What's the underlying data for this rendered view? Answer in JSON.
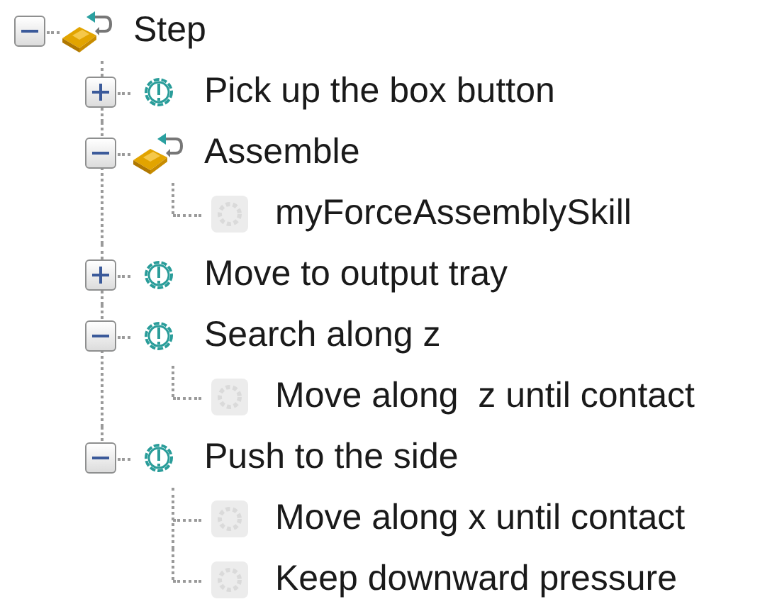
{
  "tree": [
    {
      "label": "Step",
      "kind": "sequence",
      "expanded": true,
      "children": [
        {
          "label": "Pick up the box button",
          "kind": "action",
          "expanded": false
        },
        {
          "label": "Assemble",
          "kind": "sequence",
          "expanded": true,
          "children": [
            {
              "label": "myForceAssemblySkill",
              "kind": "skill"
            }
          ]
        },
        {
          "label": "Move to output tray",
          "kind": "action",
          "expanded": false
        },
        {
          "label": "Search along z",
          "kind": "action",
          "expanded": true,
          "children": [
            {
              "label": "Move along  z until contact",
              "kind": "skill"
            }
          ]
        },
        {
          "label": "Push to the side",
          "kind": "action",
          "expanded": true,
          "children": [
            {
              "label": "Move along x until contact",
              "kind": "skill"
            },
            {
              "label": "Keep downward pressure",
              "kind": "skill"
            }
          ]
        }
      ]
    }
  ]
}
